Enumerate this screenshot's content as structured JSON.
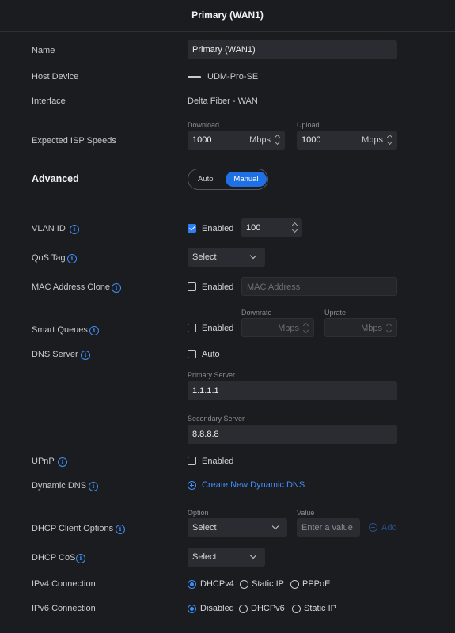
{
  "header": {
    "title": "Primary (WAN1)"
  },
  "fields": {
    "name_label": "Name",
    "name_value": "Primary (WAN1)",
    "host_label": "Host Device",
    "host_value": "UDM-Pro-SE",
    "interface_label": "Interface",
    "interface_value": "Delta Fiber - WAN",
    "speeds_label": "Expected ISP Speeds",
    "download_caption": "Download",
    "download_value": "1000",
    "download_unit": "Mbps",
    "upload_caption": "Upload",
    "upload_value": "1000",
    "upload_unit": "Mbps"
  },
  "advanced": {
    "title": "Advanced",
    "auto_label": "Auto",
    "manual_label": "Manual",
    "selected": "Manual"
  },
  "vlan": {
    "label": "VLAN ID",
    "enabled_label": "Enabled",
    "enabled": true,
    "value": "100"
  },
  "qos": {
    "label": "QoS Tag",
    "select": "Select"
  },
  "mac": {
    "label": "MAC Address Clone",
    "enabled_label": "Enabled",
    "enabled": false,
    "placeholder": "MAC Address"
  },
  "smart_queues": {
    "label": "Smart Queues",
    "enabled_label": "Enabled",
    "enabled": false,
    "downrate_caption": "Downrate",
    "uprate_caption": "Uprate",
    "downrate_unit": "Mbps",
    "uprate_unit": "Mbps"
  },
  "dns": {
    "label": "DNS Server",
    "auto_label": "Auto",
    "auto": false,
    "primary_caption": "Primary Server",
    "primary_value": "1.1.1.1",
    "secondary_caption": "Secondary Server",
    "secondary_value": "8.8.8.8"
  },
  "upnp": {
    "label": "UPnP",
    "enabled_label": "Enabled",
    "enabled": false
  },
  "ddns": {
    "label": "Dynamic DNS",
    "link": "Create New Dynamic DNS"
  },
  "dhcp_client": {
    "label": "DHCP Client Options",
    "option_caption": "Option",
    "value_caption": "Value",
    "option_select": "Select",
    "value_placeholder": "Enter a value",
    "add_label": "Add"
  },
  "dhcp_cos": {
    "label": "DHCP CoS",
    "select": "Select"
  },
  "ipv4": {
    "label": "IPv4 Connection",
    "options": [
      "DHCPv4",
      "Static IP",
      "PPPoE"
    ],
    "selected": "DHCPv4"
  },
  "ipv6": {
    "label": "IPv6 Connection",
    "options": [
      "Disabled",
      "DHCPv6",
      "Static IP"
    ],
    "selected": "Disabled"
  },
  "colors": {
    "accent": "#3f8ef5",
    "background": "#1b1c20",
    "field": "#2b2c31"
  }
}
